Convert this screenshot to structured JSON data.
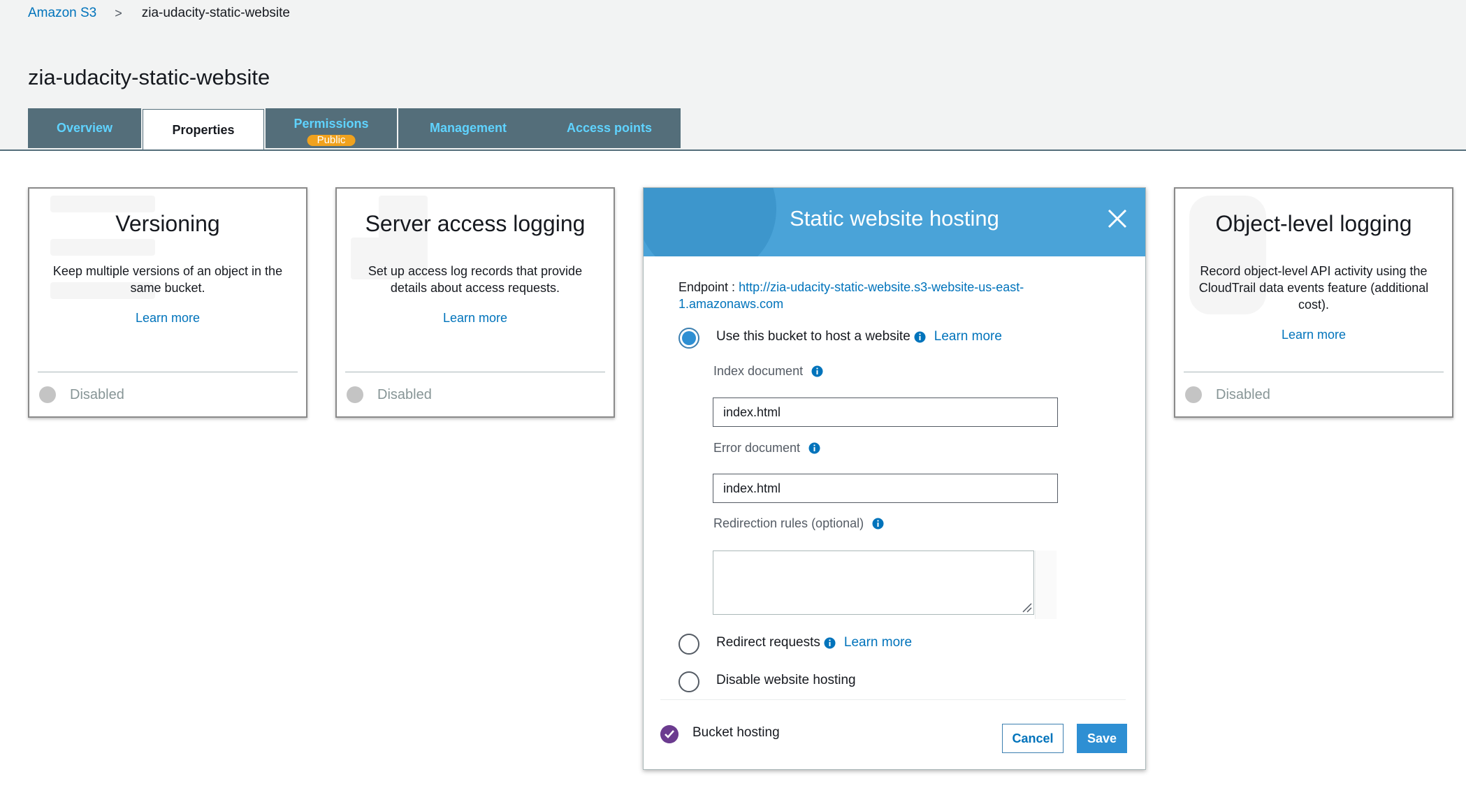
{
  "breadcrumb": {
    "root": "Amazon S3",
    "separator": ">",
    "current": "zia-udacity-static-website"
  },
  "page_title": "zia-udacity-static-website",
  "tabs": [
    {
      "label": "Overview"
    },
    {
      "label": "Properties",
      "active": true
    },
    {
      "label": "Permissions",
      "badge": "Public"
    },
    {
      "label": "Management"
    },
    {
      "label": "Access points"
    }
  ],
  "cards": {
    "versioning": {
      "title": "Versioning",
      "description": "Keep multiple versions of an object in the same bucket.",
      "link": "Learn more",
      "status": "Disabled"
    },
    "logging": {
      "title": "Server access logging",
      "description": "Set up access log records that provide details about access requests.",
      "link": "Learn more",
      "status": "Disabled"
    },
    "object_logging": {
      "title": "Object-level logging",
      "description": "Record object-level API activity using the CloudTrail data events feature (additional cost).",
      "link": "Learn more",
      "status": "Disabled"
    }
  },
  "hosting": {
    "title": "Static website hosting",
    "endpoint_label": "Endpoint :",
    "endpoint_url": "http://zia-udacity-static-website.s3-website-us-east-1.amazonaws.com",
    "option_host": "Use this bucket to host a website",
    "option_redirect": "Redirect requests",
    "option_disable": "Disable website hosting",
    "learn_more": "Learn more",
    "index_label": "Index document",
    "index_value": "index.html",
    "error_label": "Error document",
    "error_value": "index.html",
    "redirection_label": "Redirection rules (optional)",
    "footer_label": "Bucket hosting",
    "cancel": "Cancel",
    "save": "Save"
  },
  "colors": {
    "accent": "#0073bb",
    "tab_bg": "#546e7a",
    "tab_text": "#5fd3ff",
    "header_blue": "#4aa3d8",
    "badge": "#f0a21e",
    "check": "#6b3b8f"
  },
  "icons": [
    "chevron-right-icon",
    "close-icon",
    "info-icon",
    "check-icon",
    "resize-grip-icon"
  ]
}
